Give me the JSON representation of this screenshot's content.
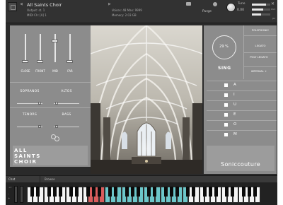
{
  "header": {
    "instrument_name": "All Saints Choir",
    "nav_prev": "◀",
    "nav_next": "▶",
    "output": "Output: st. 1",
    "midi_ch": "MIDI Ch: [A] 1",
    "voices": "Voices: 48  Max: 9999",
    "memory": "Memory: 2.03 GB",
    "purge": "Purge",
    "tune_label": "Tune",
    "tune_value": "0.00",
    "aux": "aux",
    "pv": "pv",
    "close": "✕"
  },
  "mic_mixer": {
    "channels": [
      {
        "label": "CLOSE",
        "level": 0.0
      },
      {
        "label": "FRONT",
        "level": 0.0
      },
      {
        "label": "MID",
        "level": 1.0
      },
      {
        "label": "FAR",
        "level": 0.0
      }
    ]
  },
  "sections": [
    {
      "label": "SOPRANOS"
    },
    {
      "label": "ALTOS"
    },
    {
      "label": "TENORS"
    },
    {
      "label": "BASS"
    }
  ],
  "title_block": [
    "ALL",
    "SAINTS",
    "CHOIR"
  ],
  "sing": {
    "dial_value": "29 %",
    "label": "SING"
  },
  "modes": [
    "POLYPHONIC",
    "LEGATO",
    "POLY LEGATO",
    "INTERVAL +"
  ],
  "vowels": [
    {
      "letter": "A",
      "checked": true
    },
    {
      "letter": "I",
      "checked": true
    },
    {
      "letter": "U",
      "checked": true
    },
    {
      "letter": "E",
      "checked": true
    },
    {
      "letter": "O",
      "checked": true
    },
    {
      "letter": "M",
      "checked": true
    }
  ],
  "brand": "Soniccouture",
  "bottom_tabs": {
    "chat": "Chat",
    "browse": "Browse"
  },
  "keyboard": {
    "octave_down": "-",
    "octave_up": "+",
    "wheel_labels": "+2",
    "key_range_color": "#6cc6c9",
    "keyswitch_color": "#d95c5c"
  },
  "colors": {
    "panel": "#8c8c8c",
    "accent": "#6cc6c9",
    "keyswitch": "#d95c5c"
  }
}
